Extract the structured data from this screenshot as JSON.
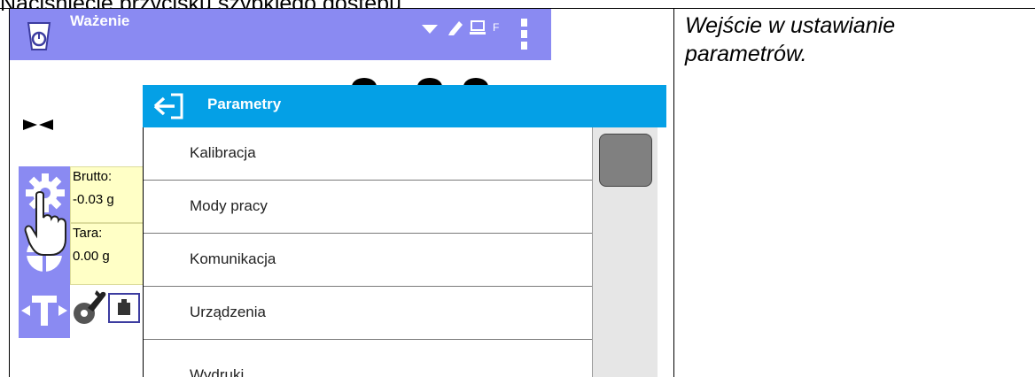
{
  "page_caption": "Naciśnięcie przycisku szybkiego dostępu.",
  "right_caption_line1": "Wejście w ustawianie",
  "right_caption_line2": "parametrów.",
  "statusbar": {
    "title": "Ważenie",
    "indicator_letter": "F",
    "background": "#8a8af2"
  },
  "info": {
    "brutto_label": "Brutto:",
    "brutto_value": "-0.03 g",
    "tara_label": "Tara:",
    "tara_value": "0.00 g",
    "background": "#ffffc6"
  },
  "dialog": {
    "title": "Parametry",
    "header_color": "#04a0e6",
    "items": [
      {
        "label": "Kalibracja"
      },
      {
        "label": "Mody pracy"
      },
      {
        "label": "Komunikacja"
      },
      {
        "label": "Urządzenia"
      },
      {
        "label": "Wydruki"
      }
    ]
  },
  "icons": {
    "scale": "scale-icon",
    "wifi": "wifi-icon",
    "pen": "pen-icon",
    "keyboard": "keyboard-icon",
    "menu": "menu-dots-icon",
    "unstable": "unstable-indicator-icon",
    "settings": "gear-icon",
    "hand": "hand-pointer-icon",
    "tare": "tare-icon",
    "wrench": "wrench-gear-icon",
    "weight": "weight-icon",
    "back": "exit-back-icon"
  }
}
